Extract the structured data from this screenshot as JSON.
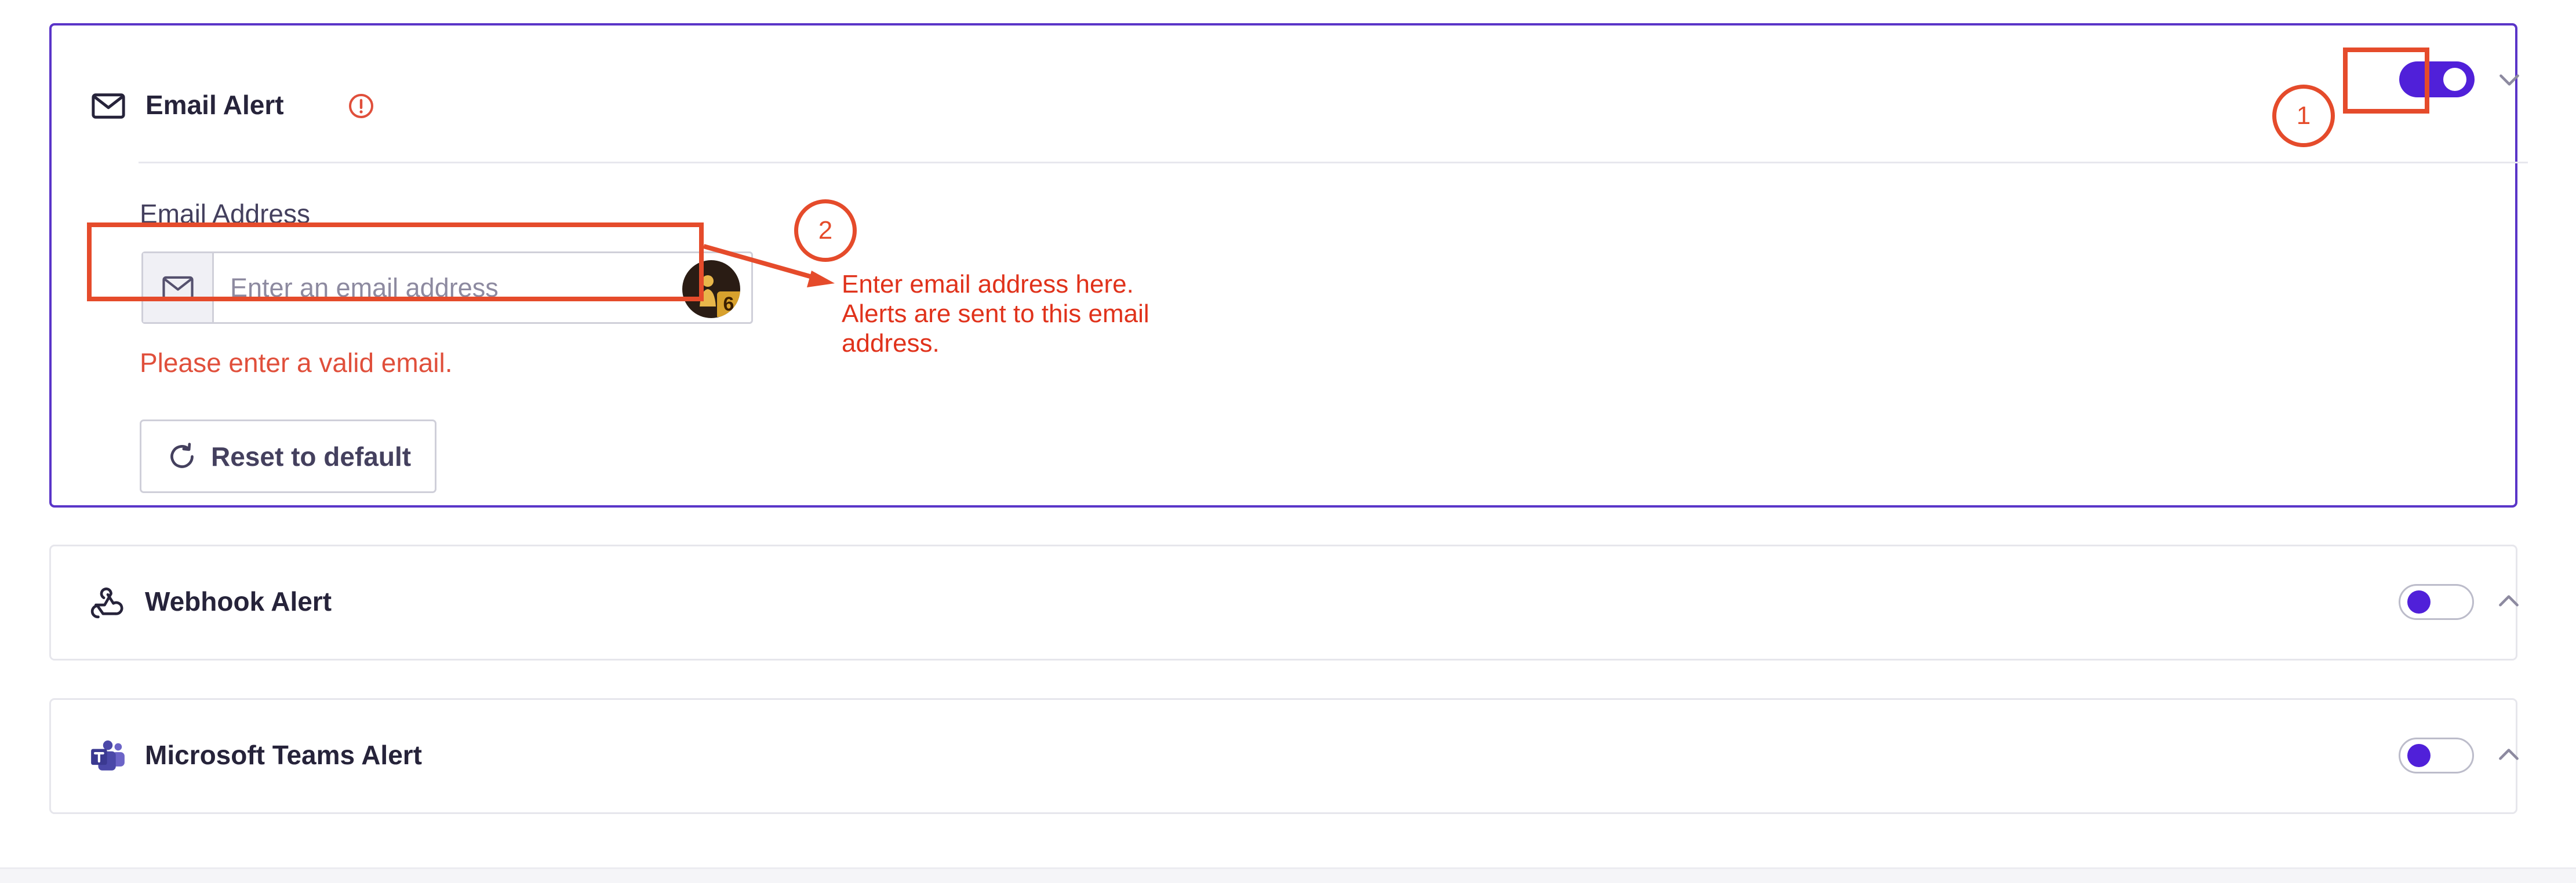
{
  "email_alert": {
    "title": "Email Alert",
    "title_icon": "envelope-icon",
    "warning_icon": "alert-circle-icon",
    "enabled": true,
    "expanded": true,
    "field_label": "Email Address",
    "input_value": "",
    "input_placeholder": "Enter an email address",
    "input_prefix_icon": "envelope-icon",
    "avatar_badge": "6",
    "error_message": "Please enter a valid email.",
    "reset_button": "Reset to default",
    "reset_icon": "refresh-icon"
  },
  "webhook_alert": {
    "title": "Webhook Alert",
    "icon": "webhook-icon",
    "enabled": false,
    "expanded": false
  },
  "teams_alert": {
    "title": "Microsoft Teams Alert",
    "icon": "microsoft-teams-icon",
    "enabled": false,
    "expanded": false
  },
  "annotations": {
    "marker_1": "1",
    "marker_2": "2",
    "note_lines": [
      "Enter email address here.",
      "Alerts are sent to this email",
      "address."
    ]
  },
  "colors": {
    "accent": "#5020d9",
    "annotation": "#e54b2b",
    "error": "#e04f3b",
    "text": "#26233a"
  }
}
